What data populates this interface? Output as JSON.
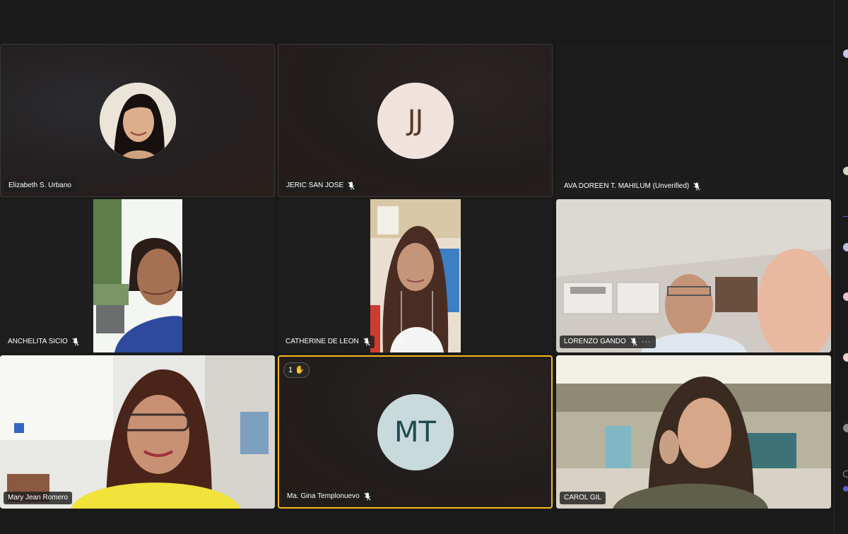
{
  "participants": [
    {
      "name": "Elizabeth S. Urbano",
      "muted": false,
      "video": "avatar-photo"
    },
    {
      "name": "JERIC SAN JOSE",
      "muted": true,
      "video": "initials",
      "initials": "JJ"
    },
    {
      "name": "AVA DOREEN T. MAHILUM (Unverified)",
      "muted": true,
      "video": "off"
    },
    {
      "name": "ANCHELITA SICIO",
      "muted": true,
      "video": "camera"
    },
    {
      "name": "CATHERINE DE LEON",
      "muted": true,
      "video": "camera"
    },
    {
      "name": "LORENZO GANDO",
      "muted": true,
      "video": "camera",
      "more": "···"
    },
    {
      "name": "Mary Jean Romero",
      "muted": false,
      "video": "camera"
    },
    {
      "name": "Ma. Gina Templonuevo",
      "muted": true,
      "video": "initials",
      "initials": "MT",
      "active_speaker": true,
      "raised_hand": {
        "count": "1",
        "icon": "raised-hand-icon",
        "glyph": "✋"
      }
    },
    {
      "name": "CAROL GIL",
      "muted": false,
      "video": "camera"
    }
  ],
  "colors": {
    "background": "#1a1a1a",
    "active_border": "#f5b81c",
    "name_tag_bg": "#1e1e1e",
    "avatar_jj_bg": "#f0e2dc",
    "avatar_mt_bg": "#c9dadc"
  },
  "icons": {
    "mute": "muted-mic-icon",
    "more": "more-options-icon",
    "hand": "raised-hand-icon"
  }
}
